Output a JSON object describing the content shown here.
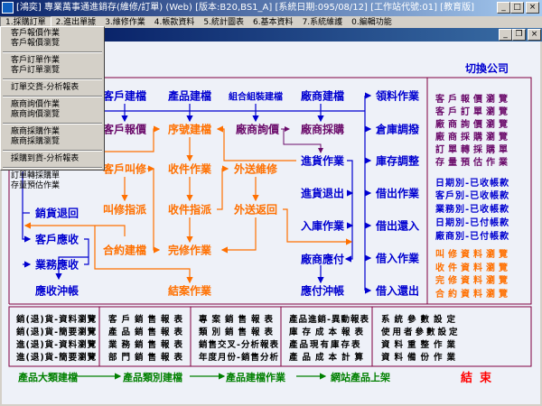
{
  "window": {
    "title": "[鴻奕] 專業萬事通進銷存(維修/訂單) (Web) [版本:B20,BS1_A] [系統日期:095/08/12] [工作站代號:01] [教育版]",
    "buttons": {
      "minimize": "_",
      "maximize": "□",
      "close": "×"
    }
  },
  "menu": [
    "1.採購訂單",
    "2.進出單據",
    "3.維修作業",
    "4.帳款資料",
    "5.統計圖表",
    "6.基本資料",
    "7.系統維護",
    "0.編輯功能"
  ],
  "dropdown": [
    [
      "客戶報價作業",
      "客戶報價瀏覽"
    ],
    [
      "客戶訂單作業",
      "客戶訂單瀏覽"
    ],
    [
      "訂單交貨-分析報表"
    ],
    [
      "廠商詢價作業",
      "廠商詢價瀏覽"
    ],
    [
      "廠商採購作業",
      "廠商採購瀏覽"
    ],
    [
      "採購到貨-分析報表"
    ],
    [
      "訂單轉採購單",
      "存量預估作業"
    ]
  ],
  "mdi_buttons": {
    "minimize": "_",
    "restore": "❐",
    "close": "×"
  },
  "switch_company": "切換公司",
  "flow": {
    "customer_master": "客戶建檔",
    "product_master": "產品建檔",
    "assembly_master": "組合組裝建檔",
    "vendor_master": "廠商建檔",
    "customer_quote": "客戶報價",
    "serial_master": "序號建檔",
    "vendor_inquiry": "廠商詢價",
    "vendor_purchase": "廠商採購",
    "receiving": "進貨作業",
    "purchase_return": "進貨退出",
    "warehousing": "入庫作業",
    "vendor_payable": "廠商應付",
    "payable_writeoff": "應付沖帳",
    "repair_call": "客戶叫修",
    "receive_job": "收件作業",
    "outsource_repair": "外送維修",
    "repair_assign": "叫修指派",
    "receive_assign": "收件指派",
    "outsource_return": "外送返回",
    "contract_master": "合約建檔",
    "repair_complete": "完修作業",
    "case_close": "結案作業",
    "sales_return": "銷貨退回",
    "customer_receivable": "客戶應收",
    "sales_receivable": "業務應收",
    "receivable_writeoff": "應收沖帳",
    "right_column": [
      "領料作業",
      "倉庫調撥",
      "庫存調整",
      "借出作業",
      "借出還入",
      "借入作業",
      "借入還出"
    ]
  },
  "side_panel": {
    "purple": [
      "客戶報價瀏覽",
      "客戶訂單瀏覽",
      "廠商詢價瀏覽",
      "廠商採購瀏覽",
      "訂單轉採購單",
      "存量預估作業"
    ],
    "blue": [
      "日期別-已收帳款",
      "客戶別-已收帳款",
      "業務別-已收帳款",
      "日期別-已付帳款",
      "廠商別-已付帳款"
    ],
    "orange": [
      "叫修資料瀏覽",
      "收件資料瀏覽",
      "完修資料瀏覽",
      "合約資料瀏覽"
    ]
  },
  "report_grid": [
    [
      "銷(退)貨-資料瀏覽",
      "銷(退)貨-簡要瀏覽",
      "進(退)貨-資料瀏覽",
      "進(退)貨-簡要瀏覽"
    ],
    [
      "客戶銷售報表",
      "產品銷售報表",
      "業務銷售報表",
      "部門銷售報表"
    ],
    [
      "專案銷售報表",
      "類別銷售報表",
      "銷售交叉-分析報表",
      "年度月份-銷售分析"
    ],
    [
      "產品進銷-異動報表",
      "庫存成本報表",
      "產品現有庫存表",
      "產品成本計算"
    ],
    [
      "系統參數設定",
      "使用者參數設定",
      "資料重整作業",
      "資料備份作業"
    ]
  ],
  "product_flow": [
    "產品大類建檔",
    "產品類別建檔",
    "產品建檔作業",
    "網站產品上架"
  ],
  "end": "結束",
  "colors": {
    "blue": "#0000d0",
    "purple": "#6a0a6a",
    "orange": "#ff7000",
    "green": "#008000",
    "red": "#ff0000",
    "frame": "#800040"
  }
}
